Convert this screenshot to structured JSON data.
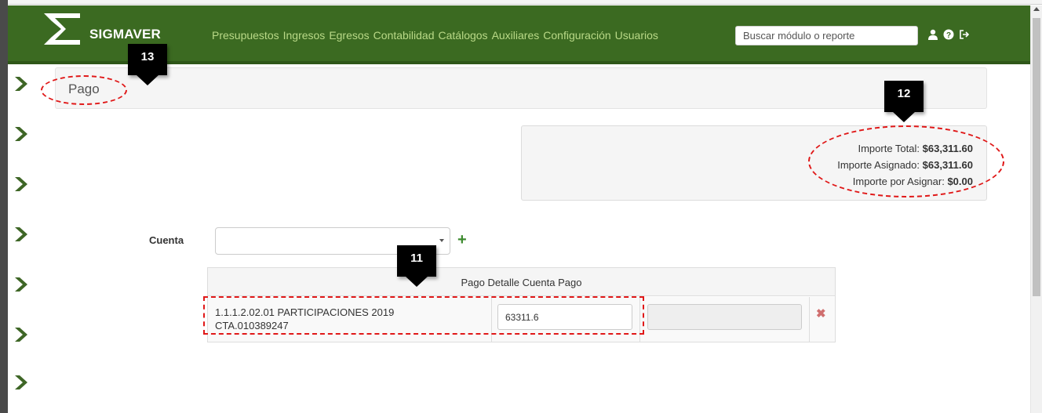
{
  "navbar": {
    "brand": "SIGMAVER",
    "links": [
      "Presupuestos",
      "Ingresos",
      "Egresos",
      "Contabilidad",
      "Catálogos",
      "Auxiliares",
      "Configuración",
      "Usuarios"
    ],
    "search_placeholder": "Buscar módulo o reporte",
    "icons": [
      "user-icon",
      "help-icon",
      "logout-icon"
    ],
    "colors": {
      "bar": "#3b6a21",
      "link": "#b9d987"
    }
  },
  "sidebar": {
    "arrow_icon": "chevron-right-icon",
    "arrow_count": 7,
    "color": "#3e6626"
  },
  "page": {
    "title": "Pago"
  },
  "amounts": {
    "total_label": "Importe Total:",
    "total_value": "$63,311.60",
    "assigned_label": "Importe Asignado:",
    "assigned_value": "$63,311.60",
    "pending_label": "Importe por Asignar:",
    "pending_value": "$0.00"
  },
  "cuenta": {
    "label": "Cuenta",
    "selected": "",
    "add_icon": "plus-icon"
  },
  "detail": {
    "header": "Pago Detalle Cuenta Pago",
    "rows": [
      {
        "account_line1": "1.1.1.2.02.01 PARTICIPACIONES 2019",
        "account_line2": "CTA.010389247",
        "amount": "63311.6"
      }
    ],
    "remove_icon": "close-icon"
  },
  "callouts": {
    "c11": "11",
    "c12": "12",
    "c13": "13",
    "highlight_color": "#e01818"
  }
}
